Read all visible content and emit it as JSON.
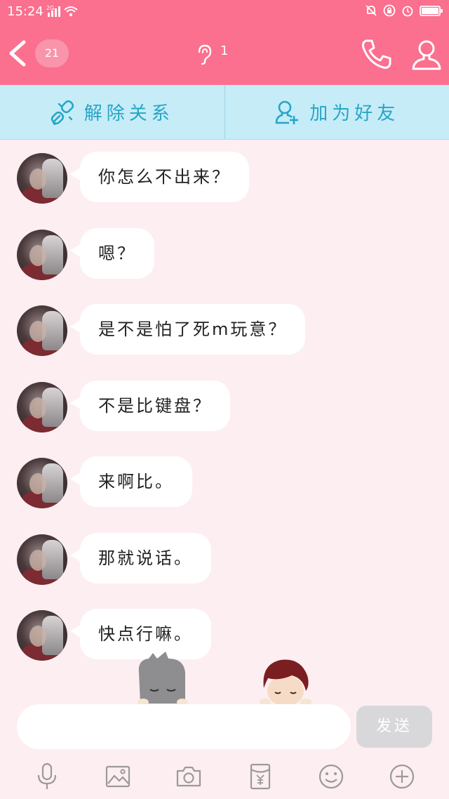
{
  "status_bar": {
    "time": "15:24",
    "network": "2G"
  },
  "header": {
    "unread_count": "21",
    "listener_count": "1"
  },
  "actions": {
    "unbind_label": "解除关系",
    "add_friend_label": "加为好友"
  },
  "messages": [
    {
      "text": "你怎么不出来？"
    },
    {
      "text": "嗯？"
    },
    {
      "text": "是不是怕了死m玩意？"
    },
    {
      "text": "不是比键盘？"
    },
    {
      "text": "来啊比。"
    },
    {
      "text": "那就说话。"
    },
    {
      "text": "快点行嘛。"
    }
  ],
  "composer": {
    "input_value": "",
    "send_label": "发送"
  },
  "toolbar": {
    "items": [
      "microphone-icon",
      "image-icon",
      "camera-icon",
      "red-packet-icon",
      "emoji-icon",
      "plus-icon"
    ]
  },
  "colors": {
    "header": "#fb6f8f",
    "action_bar": "#c6ecf7",
    "action_text": "#26a6c8",
    "background": "#fdeef1"
  }
}
